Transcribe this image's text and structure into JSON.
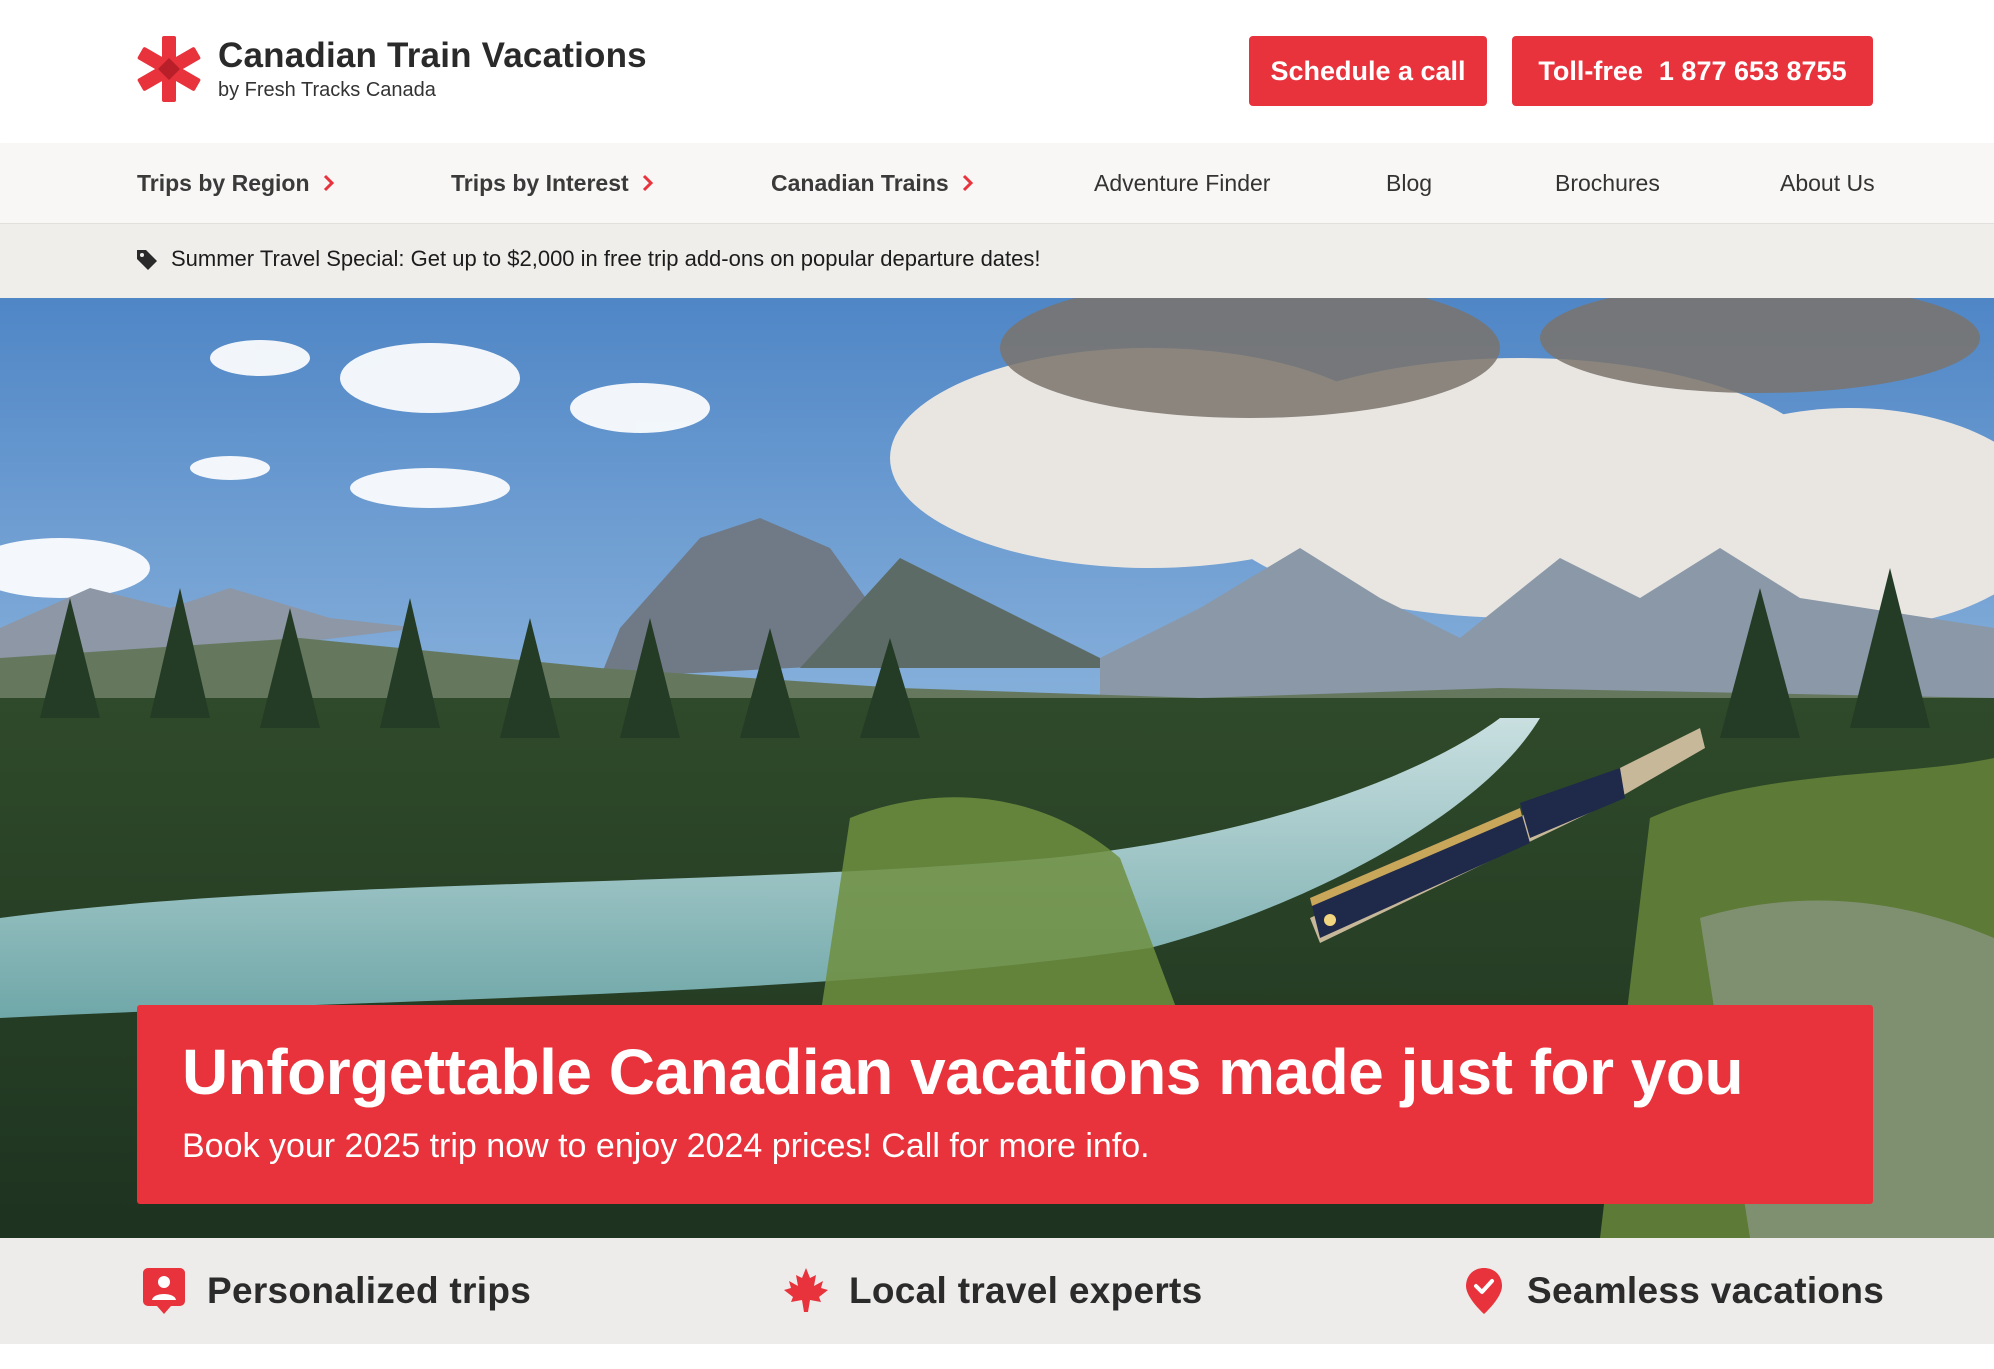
{
  "brand": {
    "title": "Canadian Train Vacations",
    "subtitle": "by Fresh Tracks Canada",
    "accent_color": "#e8323c"
  },
  "header": {
    "schedule_label": "Schedule a call",
    "tollfree_label": "Toll-free",
    "phone_number": "1 877 653 8755"
  },
  "nav": {
    "items": [
      {
        "label": "Trips by Region",
        "has_chevron": true
      },
      {
        "label": "Trips by Interest",
        "has_chevron": true
      },
      {
        "label": "Canadian Trains",
        "has_chevron": true
      },
      {
        "label": "Adventure Finder",
        "has_chevron": false
      },
      {
        "label": "Blog",
        "has_chevron": false
      },
      {
        "label": "Brochures",
        "has_chevron": false
      },
      {
        "label": "About Us",
        "has_chevron": false
      }
    ]
  },
  "promo": {
    "icon": "tag-icon",
    "text": "Summer Travel Special: Get up to $2,000 in free trip add-ons on popular departure dates!"
  },
  "hero": {
    "title": "Unforgettable Canadian vacations made just for you",
    "subtitle": "Book your 2025 trip now to enjoy 2024 prices! Call for more info."
  },
  "features": [
    {
      "icon": "person-pin-icon",
      "label": "Personalized trips"
    },
    {
      "icon": "maple-leaf-icon",
      "label": "Local travel experts"
    },
    {
      "icon": "check-pin-icon",
      "label": "Seamless vacations"
    }
  ]
}
